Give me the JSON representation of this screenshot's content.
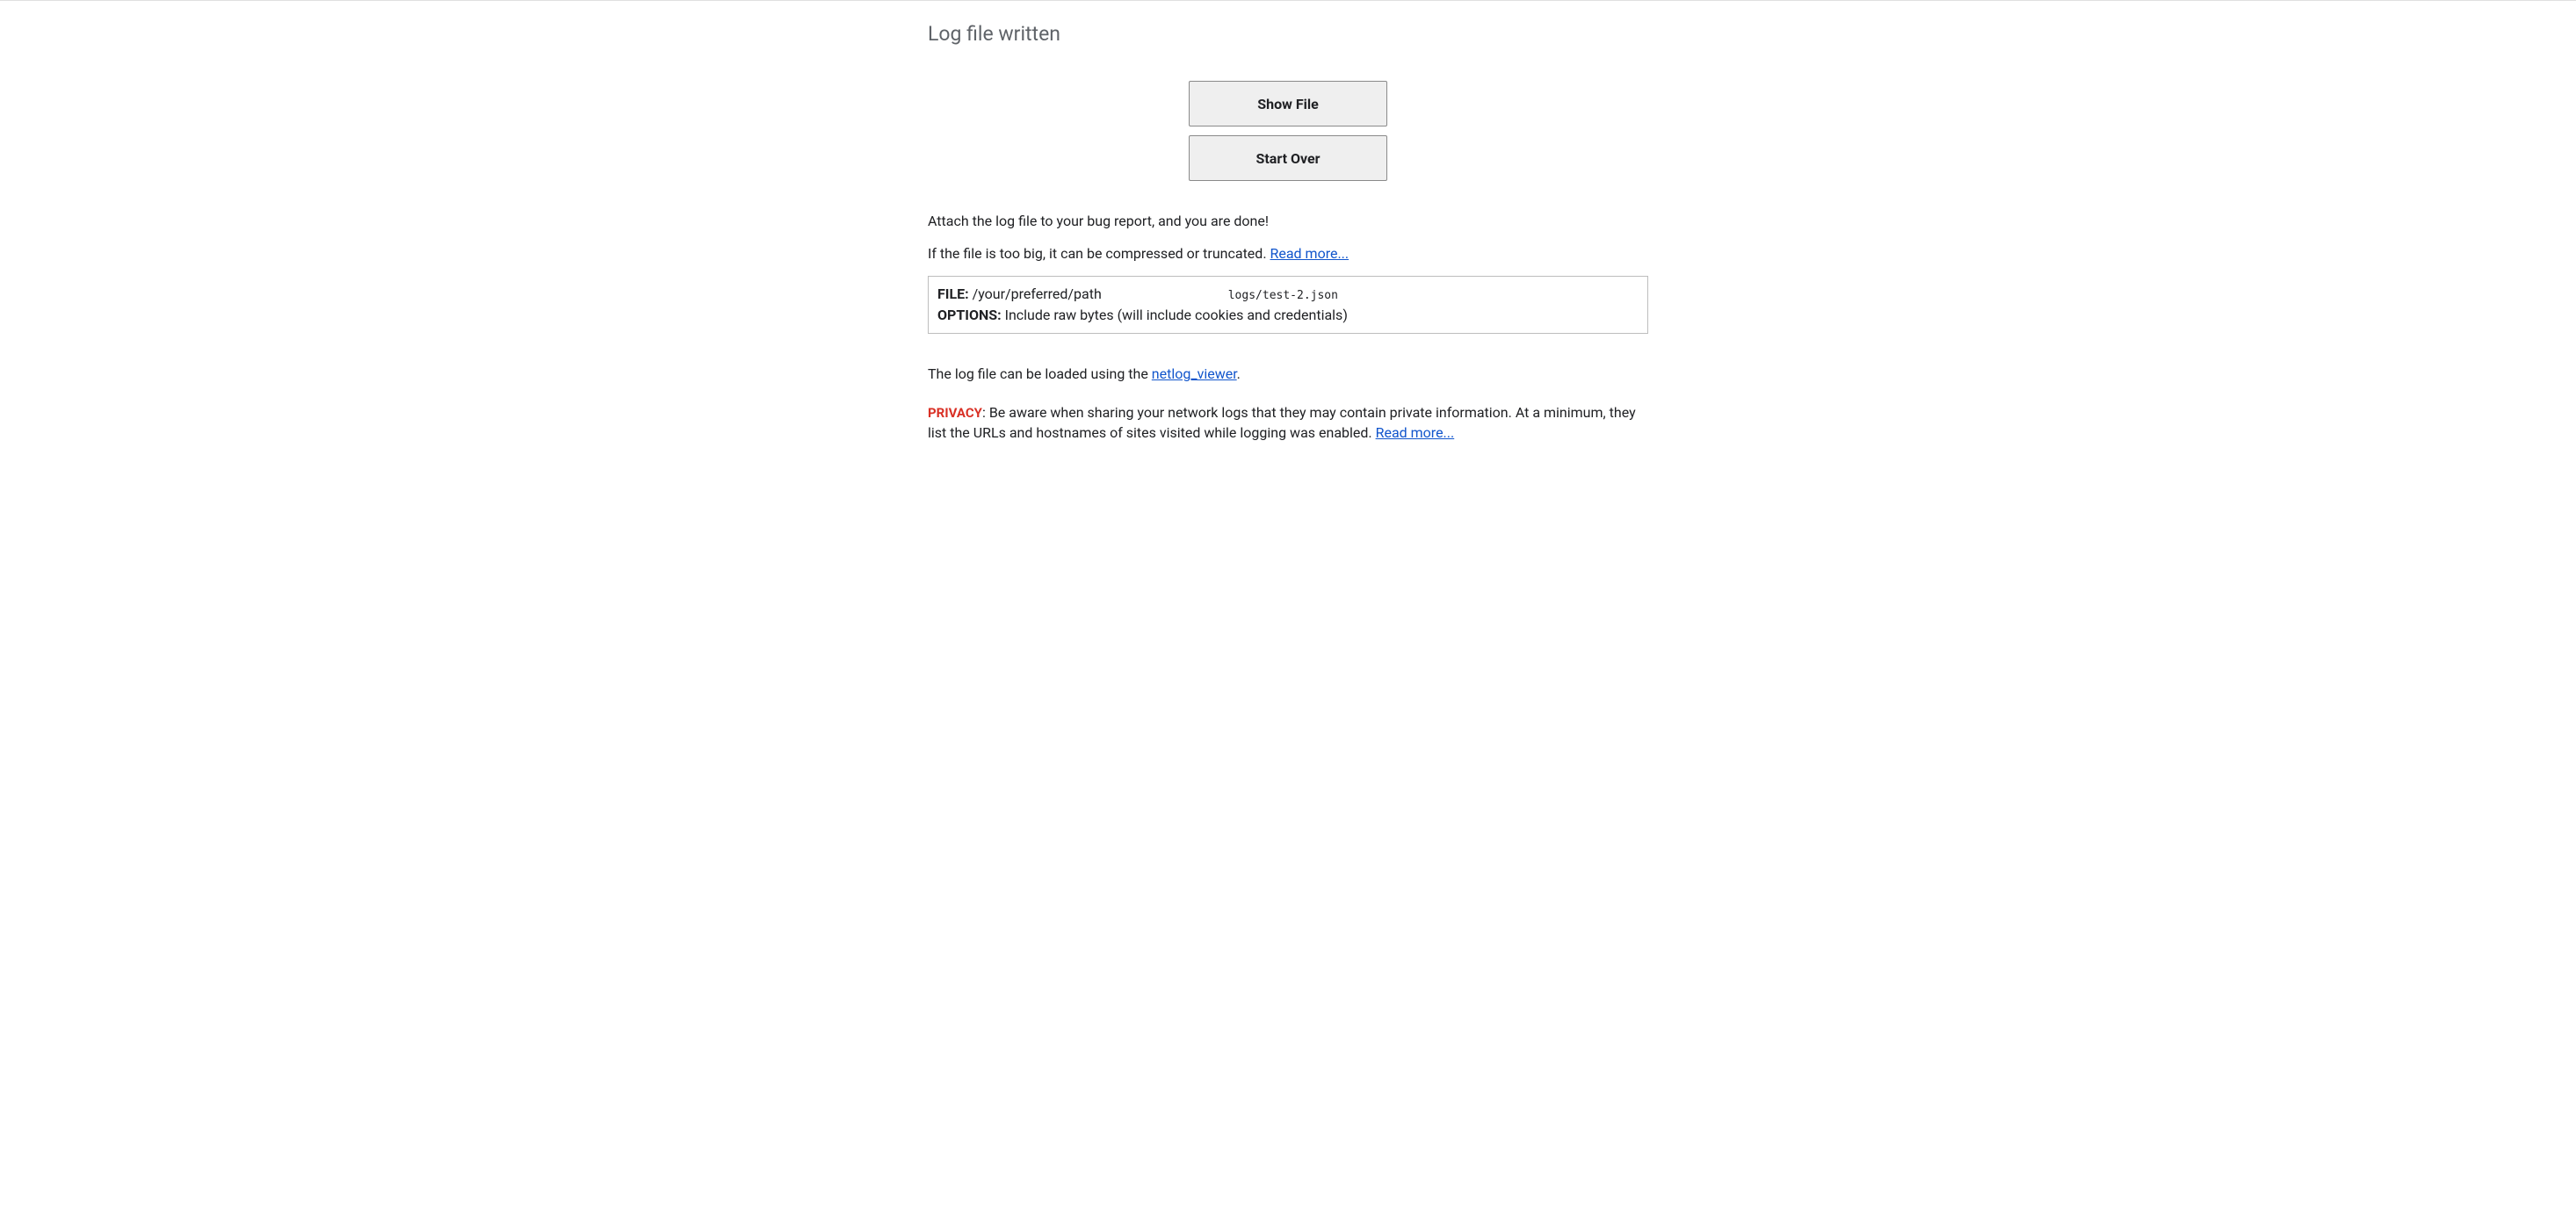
{
  "header": {
    "title": "Log file written"
  },
  "buttons": {
    "show_file": "Show File",
    "start_over": "Start Over"
  },
  "instructions": {
    "attach": "Attach the log file to your bug report, and you are done!",
    "too_big_prefix": "If the file is too big, it can be compressed or truncated. ",
    "read_more": "Read more..."
  },
  "file_info": {
    "file_label": "FILE:",
    "path_display": "/your/preferred/path",
    "path_mono": "logs/test-2.json",
    "options_label": "OPTIONS:",
    "options_value": "Include raw bytes (will include cookies and credentials)"
  },
  "viewer": {
    "prefix": "The log file can be loaded using the ",
    "link_text": "netlog_viewer",
    "suffix": "."
  },
  "privacy": {
    "label": "PRIVACY",
    "text": ": Be aware when sharing your network logs that they may contain private information. At a minimum, they list the URLs and hostnames of sites visited while logging was enabled. ",
    "read_more": "Read more..."
  }
}
